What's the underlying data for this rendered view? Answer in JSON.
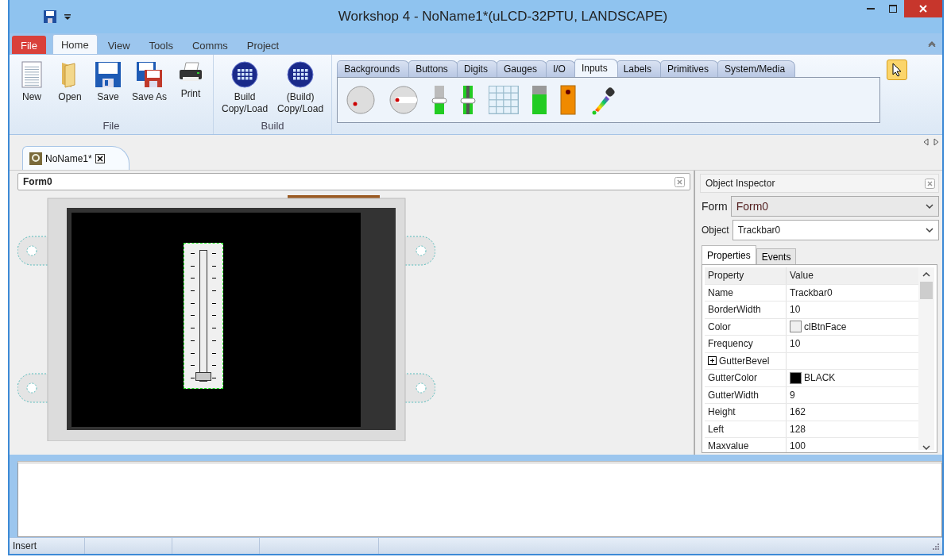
{
  "window": {
    "title": "Workshop 4 - NoName1*(uLCD-32PTU, LANDSCAPE)"
  },
  "ribbon_tabs": [
    {
      "label": "File",
      "selected": false,
      "kind": "file"
    },
    {
      "label": "Home",
      "selected": true,
      "kind": "tab"
    },
    {
      "label": "View",
      "selected": false,
      "kind": "tab"
    },
    {
      "label": "Tools",
      "selected": false,
      "kind": "tab"
    },
    {
      "label": "Comms",
      "selected": false,
      "kind": "tab"
    },
    {
      "label": "Project",
      "selected": false,
      "kind": "tab"
    }
  ],
  "ribbon_groups": [
    {
      "label": "File",
      "buttons": [
        {
          "label": "New",
          "kind": "new"
        },
        {
          "label": "Open",
          "kind": "open"
        },
        {
          "label": "Save",
          "kind": "save"
        },
        {
          "label": "Save As",
          "kind": "saveas"
        },
        {
          "label": "Print",
          "kind": "print"
        }
      ]
    },
    {
      "label": "Build",
      "buttons": [
        {
          "label": "Build\nCopy/Load",
          "kind": "build"
        },
        {
          "label": "(Build)\nCopy/Load",
          "kind": "build"
        }
      ]
    }
  ],
  "palette_tabs": [
    {
      "label": "Backgrounds",
      "selected": false
    },
    {
      "label": "Buttons",
      "selected": false
    },
    {
      "label": "Digits",
      "selected": false
    },
    {
      "label": "Gauges",
      "selected": false
    },
    {
      "label": "I/O",
      "selected": false
    },
    {
      "label": "Inputs",
      "selected": true
    },
    {
      "label": "Labels",
      "selected": false
    },
    {
      "label": "Primitives",
      "selected": false
    },
    {
      "label": "System/Media",
      "selected": false
    }
  ],
  "palette_items": [
    {
      "kind": "knob"
    },
    {
      "kind": "rotary"
    },
    {
      "kind": "slider"
    },
    {
      "kind": "trackbar"
    },
    {
      "kind": "keypad"
    },
    {
      "kind": "meter"
    },
    {
      "kind": "switch"
    },
    {
      "kind": "picker"
    }
  ],
  "doc_tabs": [
    {
      "label": "NoName1*",
      "selected": true
    }
  ],
  "form": {
    "title": "Form0",
    "trackbar": {
      "level": 0
    }
  },
  "inspector": {
    "title": "Object Inspector",
    "form_label": "Form",
    "form_value": "Form0",
    "object_label": "Object",
    "object_value": "Trackbar0",
    "tabs": [
      {
        "label": "Properties",
        "selected": true
      },
      {
        "label": "Events",
        "selected": false
      }
    ],
    "columns": [
      "Property",
      "Value"
    ],
    "rows": [
      {
        "property": "Name",
        "value": "Trackbar0"
      },
      {
        "property": "BorderWidth",
        "value": "10"
      },
      {
        "property": "Color",
        "value": "clBtnFace",
        "color": "#f0f0f0"
      },
      {
        "property": "Frequency",
        "value": "10"
      },
      {
        "property": "GutterBevel",
        "value": "",
        "expanded": false
      },
      {
        "property": "GutterColor",
        "value": "BLACK",
        "color": "#000000"
      },
      {
        "property": "GutterWidth",
        "value": "9"
      },
      {
        "property": "Height",
        "value": "162"
      },
      {
        "property": "Left",
        "value": "128"
      },
      {
        "property": "Maxvalue",
        "value": "100"
      }
    ]
  },
  "status_bar": {
    "mode": "Insert"
  }
}
